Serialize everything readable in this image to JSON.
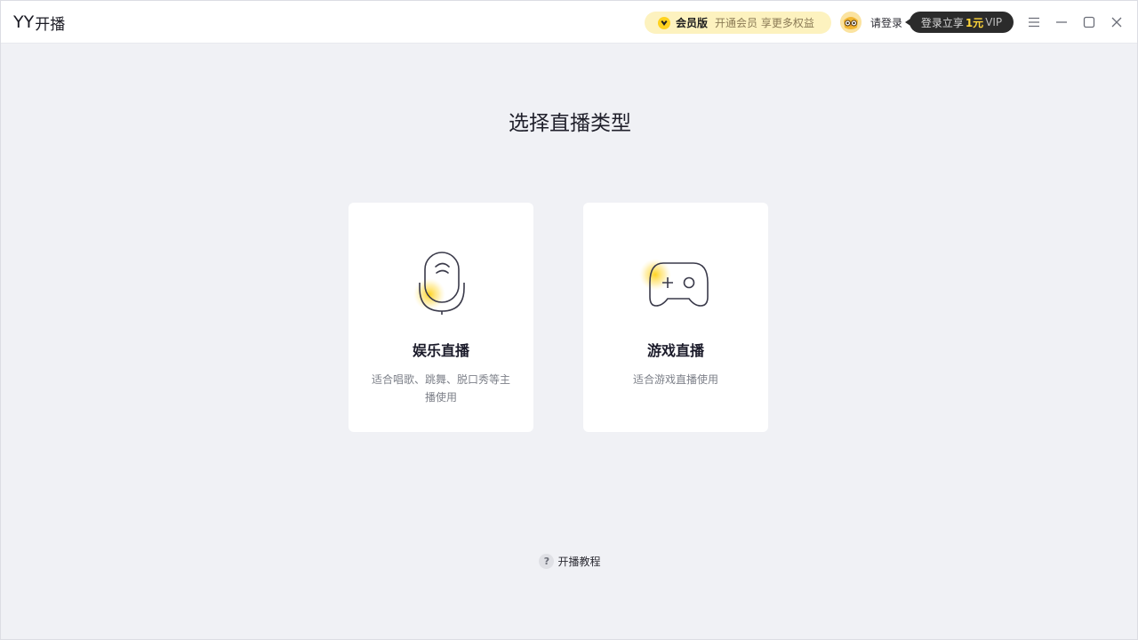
{
  "app": {
    "logo_yy": "YY",
    "logo_cn": "开播"
  },
  "header": {
    "vip_title": "会员版",
    "vip_desc": "开通会员 享更多权益",
    "login_label": "请登录",
    "promo_prefix": "登录立享",
    "promo_price": "1元",
    "promo_suffix": "VIP"
  },
  "icons": {
    "menu": "menu-icon",
    "minimize": "minimize-icon",
    "maximize": "maximize-icon",
    "close": "close-icon"
  },
  "main": {
    "title": "选择直播类型",
    "cards": [
      {
        "icon": "microphone-icon",
        "title": "娱乐直播",
        "desc": "适合唱歌、跳舞、脱口秀等主播使用"
      },
      {
        "icon": "gamepad-icon",
        "title": "游戏直播",
        "desc": "适合游戏直播使用"
      }
    ]
  },
  "footer": {
    "help_label": "开播教程"
  },
  "colors": {
    "background": "#f0f1f5",
    "vip_pill": "#fdf2bf",
    "accent_yellow": "#ffd53a",
    "promo_bg": "#2b2b2b"
  }
}
